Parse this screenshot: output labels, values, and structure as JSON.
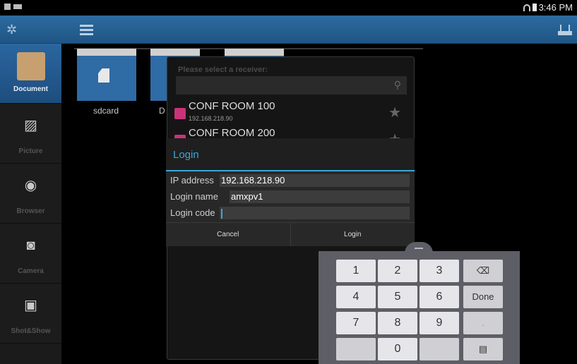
{
  "status_bar": {
    "time": "3:46 PM"
  },
  "sidebar": {
    "items": [
      {
        "label": "Document",
        "icon": "document-icon"
      },
      {
        "label": "Picture",
        "icon": "picture-icon"
      },
      {
        "label": "Browser",
        "icon": "globe-icon"
      },
      {
        "label": "Camera",
        "icon": "camera-icon"
      },
      {
        "label": "Shot&Show",
        "icon": "shotshow-icon"
      }
    ]
  },
  "main": {
    "folders": [
      {
        "label": "sdcard"
      },
      {
        "label": "D"
      }
    ]
  },
  "receiver_dialog": {
    "prompt": "Please select a receiver:",
    "items": [
      {
        "name": "CONF ROOM 100",
        "ip": "192.168.218.90"
      },
      {
        "name": "CONF ROOM 200"
      }
    ]
  },
  "login_dialog": {
    "title": "Login",
    "ip_label": "IP address",
    "ip_value": "192.168.218.90",
    "name_label": "Login name",
    "name_value": "amxpv1",
    "code_label": "Login code",
    "code_value": "",
    "cancel_label": "Cancel",
    "login_label": "Login"
  },
  "keypad": {
    "keys": [
      "1",
      "2",
      "3",
      "4",
      "5",
      "6",
      "7",
      "8",
      "9",
      "0"
    ],
    "done_label": "Done",
    "dot_label": "."
  }
}
